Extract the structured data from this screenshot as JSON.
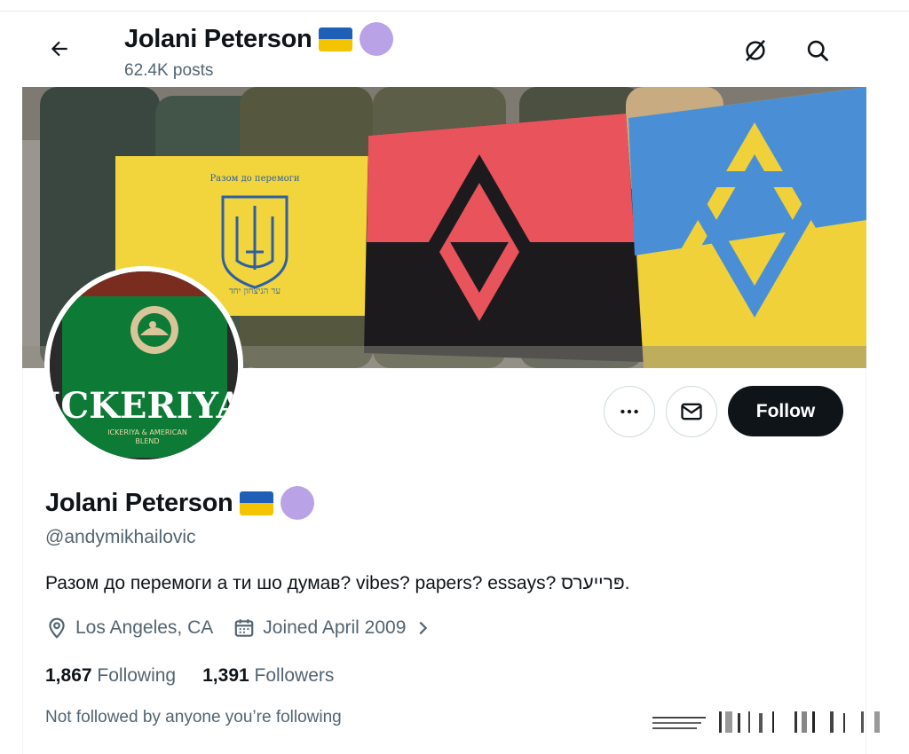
{
  "header": {
    "name": "Jolani Peterson",
    "posts": "62.4K posts"
  },
  "banner": {
    "emblem_text": "Разом до перемоги",
    "hebrew_text": "עד הניצחון יחד"
  },
  "avatar": {
    "brand": "ICKERIYA",
    "sub1": "ICKERIYA & AMERICAN",
    "sub2": "BLEND"
  },
  "actions": {
    "follow_label": "Follow"
  },
  "profile": {
    "name": "Jolani Peterson",
    "handle": "@andymikhailovic",
    "bio": "Разом до перемоги а ти шо думав? vibes? papers? essays? פּרייערס.",
    "location": "Los Angeles, CA",
    "joined": "Joined April 2009",
    "following_count": "1,867",
    "following_label": "Following",
    "followers_count": "1,391",
    "followers_label": "Followers",
    "not_followed": "Not followed by anyone you’re following"
  },
  "colors": {
    "follow_bg": "#0f1419",
    "muted": "#536471",
    "purple": "#b9a2e6",
    "ukraine_blue": "#1f5fb8",
    "ukraine_yellow": "#f5c400"
  },
  "icons": [
    "back-arrow-icon",
    "no-grok-icon",
    "search-icon",
    "more-icon",
    "message-icon",
    "location-icon",
    "calendar-icon",
    "chevron-right-icon"
  ]
}
